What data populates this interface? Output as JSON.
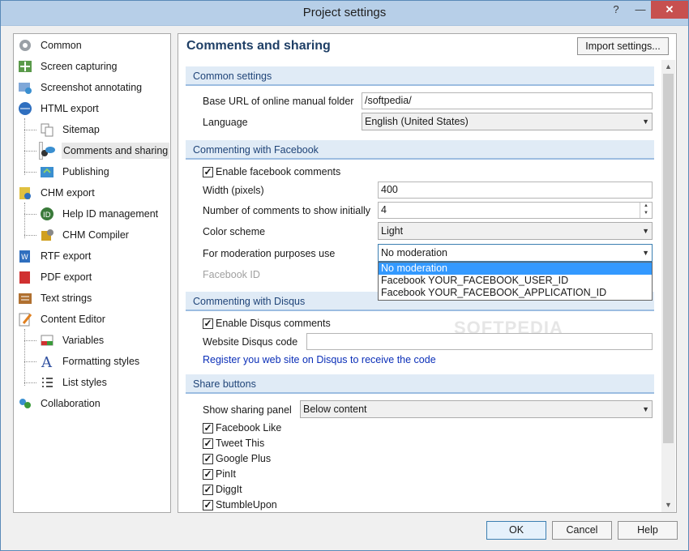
{
  "window": {
    "title": "Project settings",
    "help_glyph": "?",
    "min_glyph": "—",
    "close_glyph": "✕"
  },
  "tree": [
    {
      "label": "Common",
      "icon": "gear-icon",
      "level": 0
    },
    {
      "label": "Screen capturing",
      "icon": "screen-capture-icon",
      "level": 0
    },
    {
      "label": "Screenshot annotating",
      "icon": "annotate-icon",
      "level": 0
    },
    {
      "label": "HTML export",
      "icon": "html-export-icon",
      "level": 0
    },
    {
      "label": "Sitemap",
      "icon": "sitemap-icon",
      "level": 1
    },
    {
      "label": "Comments and sharing",
      "icon": "comments-icon",
      "level": 1,
      "selected": true
    },
    {
      "label": "Publishing",
      "icon": "publishing-icon",
      "level": 1
    },
    {
      "label": "CHM export",
      "icon": "chm-export-icon",
      "level": 0
    },
    {
      "label": "Help ID management",
      "icon": "help-id-icon",
      "level": 1
    },
    {
      "label": "CHM Compiler",
      "icon": "chm-compiler-icon",
      "level": 1
    },
    {
      "label": "RTF export",
      "icon": "rtf-export-icon",
      "level": 0
    },
    {
      "label": "PDF export",
      "icon": "pdf-export-icon",
      "level": 0
    },
    {
      "label": "Text strings",
      "icon": "text-strings-icon",
      "level": 0
    },
    {
      "label": "Content Editor",
      "icon": "content-editor-icon",
      "level": 0
    },
    {
      "label": "Variables",
      "icon": "variables-icon",
      "level": 1
    },
    {
      "label": "Formatting styles",
      "icon": "formatting-styles-icon",
      "level": 1
    },
    {
      "label": "List styles",
      "icon": "list-styles-icon",
      "level": 1
    },
    {
      "label": "Collaboration",
      "icon": "collaboration-icon",
      "level": 0
    }
  ],
  "panel": {
    "title": "Comments and sharing",
    "import_label": "Import settings...",
    "common": {
      "header": "Common settings",
      "base_url_label": "Base URL of online manual folder",
      "base_url_value": "/softpedia/",
      "language_label": "Language",
      "language_value": "English (United States)"
    },
    "facebook": {
      "header": "Commenting with Facebook",
      "enable_label": "Enable facebook comments",
      "enable_checked": true,
      "width_label": "Width (pixels)",
      "width_value": "400",
      "count_label": "Number of comments to show initially",
      "count_value": "4",
      "scheme_label": "Color scheme",
      "scheme_value": "Light",
      "moderation_label": "For moderation purposes use",
      "moderation_value": "No moderation",
      "moderation_options": [
        "No moderation",
        "Facebook YOUR_FACEBOOK_USER_ID",
        "Facebook YOUR_FACEBOOK_APPLICATION_ID"
      ],
      "fbid_label": "Facebook ID"
    },
    "disqus": {
      "header": "Commenting with Disqus",
      "enable_label": "Enable Disqus comments",
      "enable_checked": true,
      "code_label": "Website Disqus code",
      "code_value": "",
      "register_link": "Register you web site on Disqus to receive the code"
    },
    "share": {
      "header": "Share buttons",
      "panel_label": "Show sharing panel",
      "panel_value": "Below content",
      "buttons": [
        {
          "label": "Facebook Like",
          "checked": true
        },
        {
          "label": "Tweet This",
          "checked": true
        },
        {
          "label": "Google Plus",
          "checked": true
        },
        {
          "label": "PinIt",
          "checked": true
        },
        {
          "label": "DiggIt",
          "checked": true
        },
        {
          "label": "StumbleUpon",
          "checked": true
        }
      ]
    },
    "watermark": "SOFTPEDIA"
  },
  "footer": {
    "ok_label": "OK",
    "cancel_label": "Cancel",
    "help_label": "Help"
  },
  "glyphs": {
    "dropdown_arrow": "▼",
    "scroll_up": "▲",
    "scroll_down": "▼",
    "check": "✓"
  },
  "colors": {
    "title_bar": "#b7cfe8",
    "section_header": "#e0ebf6",
    "section_text": "#1f4478",
    "link": "#0b2fb8",
    "highlight": "#3399ff",
    "close_button": "#c7504f"
  }
}
